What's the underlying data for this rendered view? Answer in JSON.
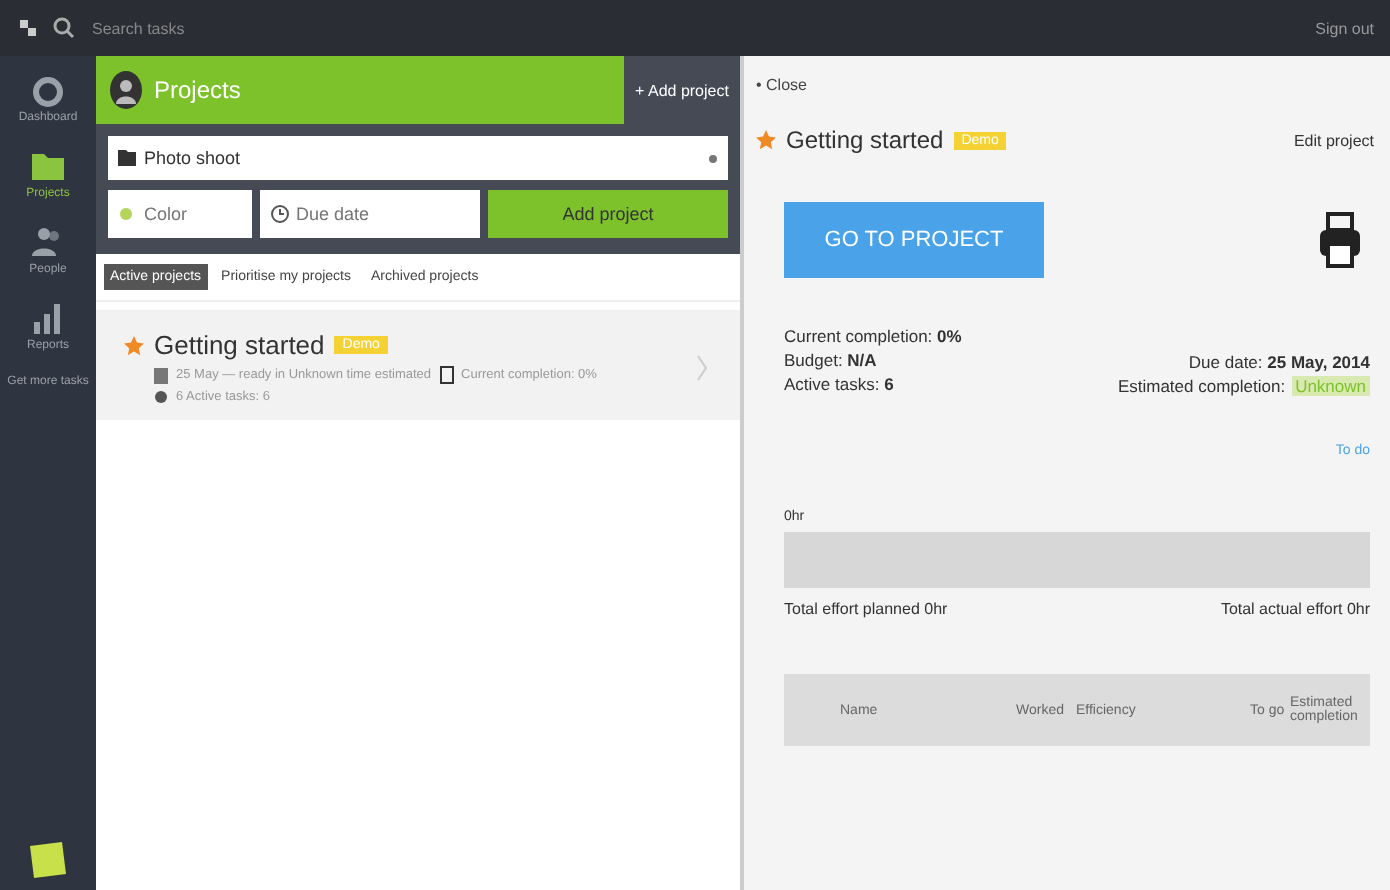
{
  "topbar": {
    "search_placeholder": "Search tasks",
    "user": "Sign out"
  },
  "sidebar": {
    "items": [
      {
        "label": "Dashboard",
        "kind": "gauge",
        "selected": false
      },
      {
        "label": "Projects",
        "kind": "folder",
        "selected": true
      },
      {
        "label": "People",
        "kind": "people",
        "selected": false
      },
      {
        "label": "Reports",
        "kind": "bars",
        "selected": false
      },
      {
        "label": "Get more tasks",
        "kind": "text",
        "selected": false
      }
    ]
  },
  "projects": {
    "title": "Projects",
    "add_link": "+ Add project",
    "name_value": "Photo shoot",
    "color_placeholder": "Color",
    "due_placeholder": "Due date",
    "add_button": "Add project",
    "tabs": [
      {
        "label": "Active projects",
        "selected": true
      },
      {
        "label": "Prioritise my projects",
        "selected": false
      },
      {
        "label": "Archived projects",
        "selected": false
      }
    ],
    "items": [
      {
        "title": "Getting started",
        "badge": "Demo",
        "dates": "25 May — ready in Unknown time estimated",
        "completion": "Current completion: 0%",
        "tasks": "6 Active tasks: 6"
      }
    ]
  },
  "details": {
    "close": "• Close",
    "title": "Getting started",
    "badge": "Demo",
    "edit": "Edit project",
    "go_button": "GO TO PROJECT",
    "left_stats": [
      "Current completion: **0%**",
      "Budget: **N/A**",
      "Active tasks: **6**"
    ],
    "due": "Due date: **25 May, 2014**",
    "estimated_label": "Estimated completion:",
    "estimated_value": "Unknown",
    "todo": "To do",
    "bar_label": "0hr",
    "planned": "Total effort planned 0hr",
    "actual": "Total actual effort 0hr",
    "columns": [
      "Name",
      "Worked",
      "Efficiency",
      "To go",
      "Estimated completion"
    ]
  }
}
